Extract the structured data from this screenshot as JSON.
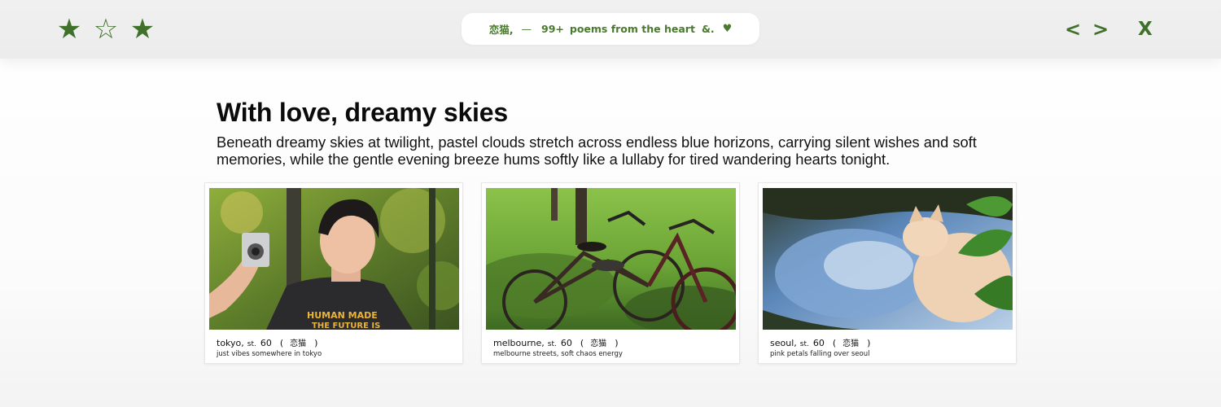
{
  "header": {
    "stars": [
      {
        "icon": "star-filled-icon",
        "glyph": "★"
      },
      {
        "icon": "star-outline-icon",
        "glyph": "☆"
      },
      {
        "icon": "star-filled-icon",
        "glyph": "★"
      }
    ],
    "tagline": {
      "name": "恋猫,",
      "dash": "—",
      "count": "99+",
      "text": "poems from the heart",
      "amp": "&.",
      "heart": "♥"
    },
    "prev_label": "<",
    "next_label": ">",
    "close_label": "X"
  },
  "main": {
    "title": "With love, dreamy skies",
    "description": "Beneath dreamy skies at twilight, pastel clouds stretch across endless blue horizons, carrying silent wishes and soft memories, while the gentle evening breeze hums softly like a lullaby for tired wandering hearts tonight."
  },
  "cards": [
    {
      "city": "tokyo,",
      "st": "st.",
      "number": "60",
      "open_paren": "(",
      "kanji": "恋猫",
      "close_paren": ")",
      "subtitle": "just vibes somewhere in tokyo"
    },
    {
      "city": "melbourne,",
      "st": "st.",
      "number": "60",
      "open_paren": "(",
      "kanji": "恋猫",
      "close_paren": ")",
      "subtitle": "melbourne streets, soft chaos energy"
    },
    {
      "city": "seoul,",
      "st": "st.",
      "number": "60",
      "open_paren": "(",
      "kanji": "恋猫",
      "close_paren": ")",
      "subtitle": "pink petals falling over seoul"
    }
  ],
  "colors": {
    "accent_green": "#40712a",
    "pill_text": "#4a7a2e",
    "topbar_bg": "#eeeeee"
  }
}
